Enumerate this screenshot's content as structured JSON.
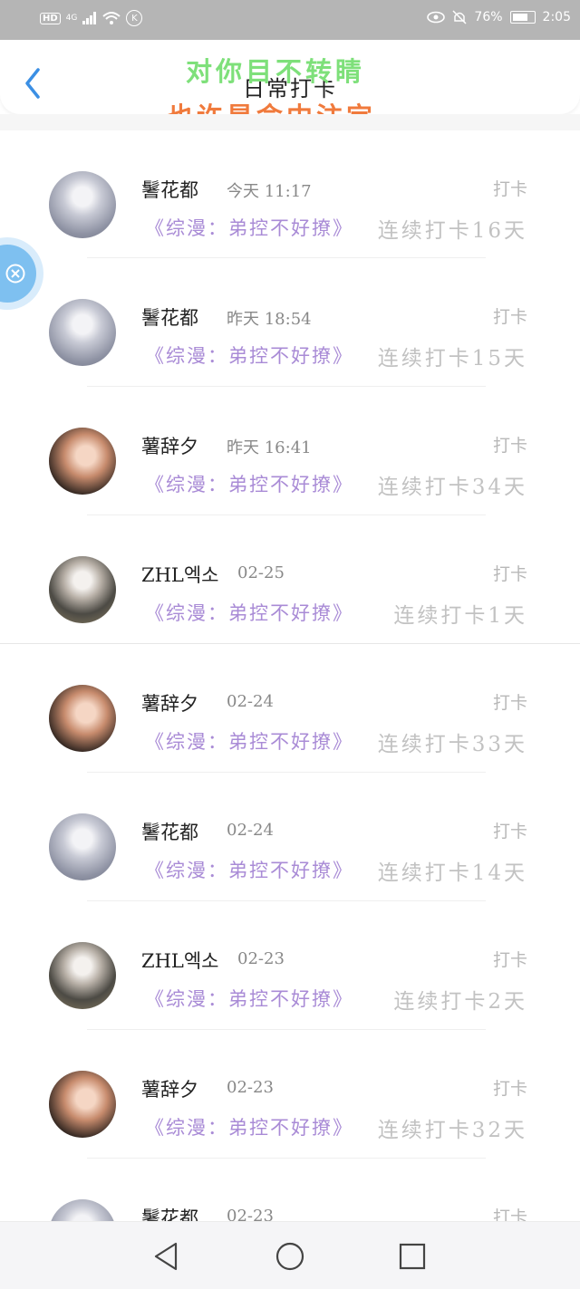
{
  "status_bar": {
    "left_badge": "HD",
    "network": "4G",
    "k_badge": "K",
    "battery": "76%",
    "time": "2:05"
  },
  "header": {
    "title": "日常打卡",
    "overlay_line1": "对你目不转睛",
    "overlay_line2": "也许是命中注定",
    "back_icon": "chevron-left-icon"
  },
  "checkins": [
    {
      "user": "鬐花都",
      "time": "今天 11:17",
      "action": "打卡",
      "book": "《综漫：弟控不好撩》",
      "streak": "连续打卡16天",
      "avatar": "a"
    },
    {
      "user": "鬐花都",
      "time": "昨天 18:54",
      "action": "打卡",
      "book": "《综漫：弟控不好撩》",
      "streak": "连续打卡15天",
      "avatar": "a"
    },
    {
      "user": "薯辞夕",
      "time": "昨天 16:41",
      "action": "打卡",
      "book": "《综漫：弟控不好撩》",
      "streak": "连续打卡34天",
      "avatar": "b"
    },
    {
      "user": "ZHL엑소",
      "time": "02-25",
      "action": "打卡",
      "book": "《综漫：弟控不好撩》",
      "streak": "连续打卡1天",
      "avatar": "c"
    },
    {
      "user": "薯辞夕",
      "time": "02-24",
      "action": "打卡",
      "book": "《综漫：弟控不好撩》",
      "streak": "连续打卡33天",
      "avatar": "b"
    },
    {
      "user": "鬐花都",
      "time": "02-24",
      "action": "打卡",
      "book": "《综漫：弟控不好撩》",
      "streak": "连续打卡14天",
      "avatar": "a"
    },
    {
      "user": "ZHL엑소",
      "time": "02-23",
      "action": "打卡",
      "book": "《综漫：弟控不好撩》",
      "streak": "连续打卡2天",
      "avatar": "c"
    },
    {
      "user": "薯辞夕",
      "time": "02-23",
      "action": "打卡",
      "book": "《综漫：弟控不好撩》",
      "streak": "连续打卡32天",
      "avatar": "b"
    },
    {
      "user": "鬐花都",
      "time": "02-23",
      "action": "打卡",
      "book": "",
      "streak": "",
      "avatar": "a"
    }
  ],
  "nav": {
    "back": "triangle-back-icon",
    "home": "circle-home-icon",
    "recents": "square-recents-icon"
  }
}
